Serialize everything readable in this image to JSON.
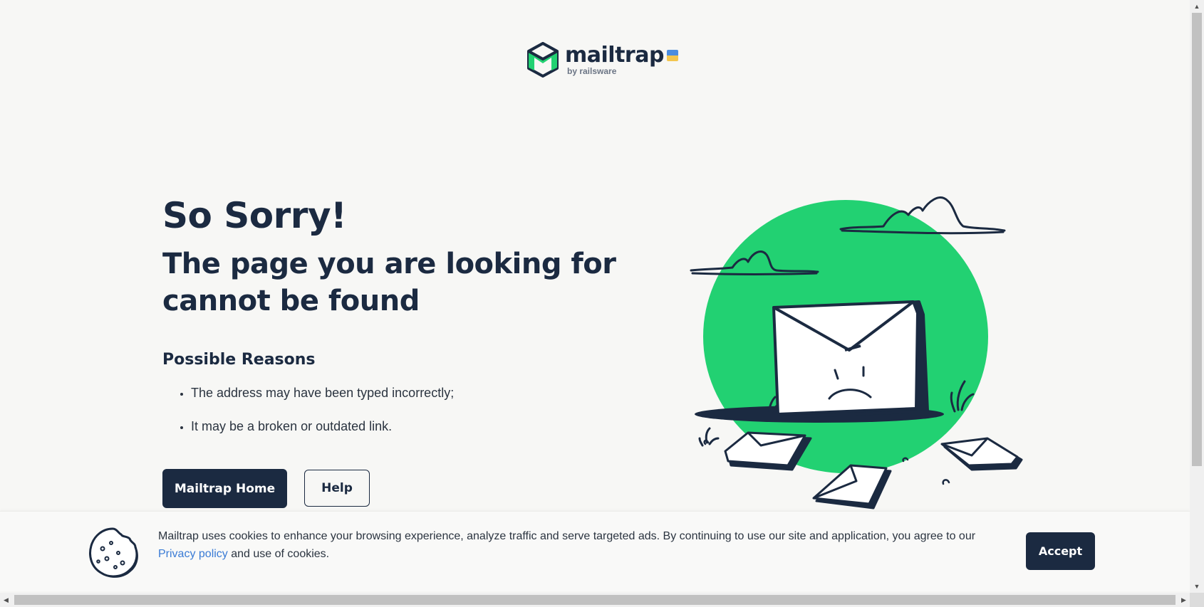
{
  "brand": {
    "name": "mailtrap",
    "byline": "by railsware",
    "mark_color": "#22d172",
    "dark_color": "#1b2a41",
    "flag_colors": [
      "#4b8de0",
      "#f3c64f"
    ]
  },
  "error": {
    "title": "So Sorry!",
    "subtitle_line1": "The page you are looking for",
    "subtitle_line2": "cannot be found",
    "reasons_title": "Possible Reasons",
    "reasons": [
      "The address may have been typed incorrectly;",
      "It may be a broken or outdated link."
    ]
  },
  "actions": {
    "home_label": "Mailtrap Home",
    "help_label": "Help"
  },
  "illustration": {
    "icon": "sad-envelope-illustration",
    "circle_color": "#22d172"
  },
  "cookie_banner": {
    "icon": "cookie-icon",
    "text_before": "Mailtrap uses cookies to enhance your browsing experience, analyze traffic and serve targeted ads. By continuing to use our site and application, you agree to our ",
    "link_label": "Privacy policy",
    "text_after": " and use of cookies.",
    "accept_label": "Accept",
    "link_color": "#3a7bd5"
  },
  "scrollbars": {
    "up_arrow": "▲",
    "down_arrow": "▼",
    "left_arrow": "◀",
    "right_arrow": "▶"
  }
}
